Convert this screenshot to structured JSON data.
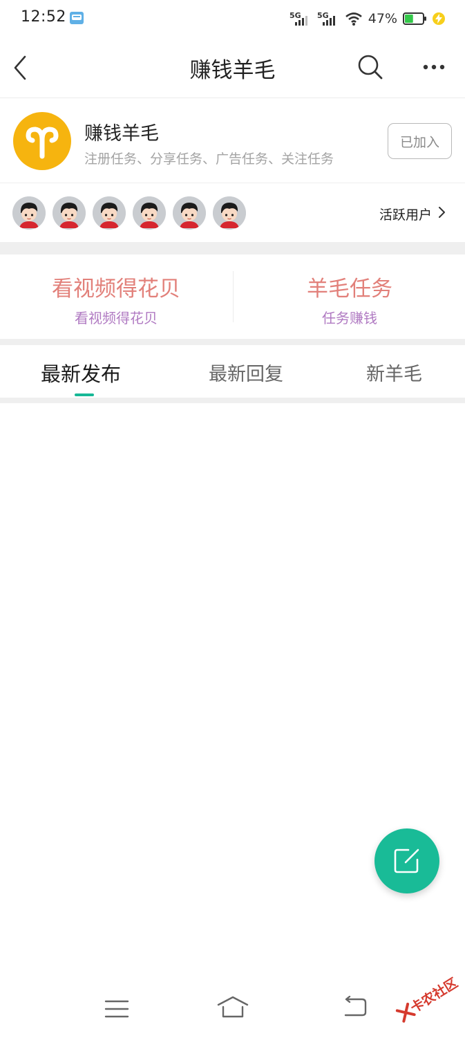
{
  "status_bar": {
    "time": "12:52",
    "network_1": "5G",
    "network_2": "5G",
    "battery_percent": "47%",
    "battery_level": 0.47
  },
  "title_bar": {
    "title": "赚钱羊毛"
  },
  "group": {
    "name": "赚钱羊毛",
    "description": "注册任务、分享任务、广告任务、关注任务",
    "join_label": "已加入",
    "avatar_color": "#f6b40f"
  },
  "active_users": {
    "label": "活跃用户",
    "avatars": [
      "user",
      "user",
      "user",
      "user",
      "user",
      "user"
    ]
  },
  "tasks": [
    {
      "title": "看视频得花贝",
      "subtitle": "看视频得花贝"
    },
    {
      "title": "羊毛任务",
      "subtitle": "任务赚钱"
    }
  ],
  "tabs": [
    {
      "label": "最新发布",
      "active": true
    },
    {
      "label": "最新回复",
      "active": false
    },
    {
      "label": "新羊毛",
      "active": false
    }
  ],
  "colors": {
    "accent": "#19bb97",
    "task_title": "#e2807a",
    "task_subtitle": "#b07ac2"
  },
  "watermark": {
    "text": "卡农社区"
  }
}
